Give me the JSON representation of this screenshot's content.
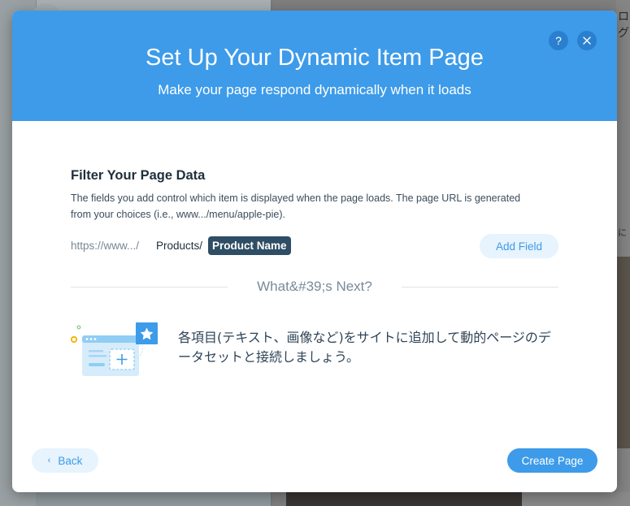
{
  "background": {
    "right_text_top": "ログ",
    "right_text_mid": "に"
  },
  "modal": {
    "title": "Set Up Your Dynamic Item Page",
    "subtitle": "Make your page respond dynamically when it loads",
    "help_label": "?",
    "colors": {
      "header": "#3d9be9",
      "primary": "#3d9be9",
      "secondary_bg": "#e7f3fd",
      "chip": "#2f4d64"
    }
  },
  "filter": {
    "title": "Filter Your Page Data",
    "description": "The fields you add control which item is displayed when the page loads. The page URL is generated from your choices (i.e., www.../menu/apple-pie).",
    "url_prefix": "https://www.../",
    "url_segment": "Products/",
    "url_chip": "Product Name",
    "add_field_label": "Add Field"
  },
  "next": {
    "heading": "What&#39;s Next?",
    "text": "各項目(テキスト、画像など)をサイトに追加して動的ページのデータセットと接続しましょう。",
    "illustration_icon": "dataset-connect-illustration"
  },
  "footer": {
    "back_label": "Back",
    "back_chevron": "‹",
    "create_label": "Create Page"
  }
}
